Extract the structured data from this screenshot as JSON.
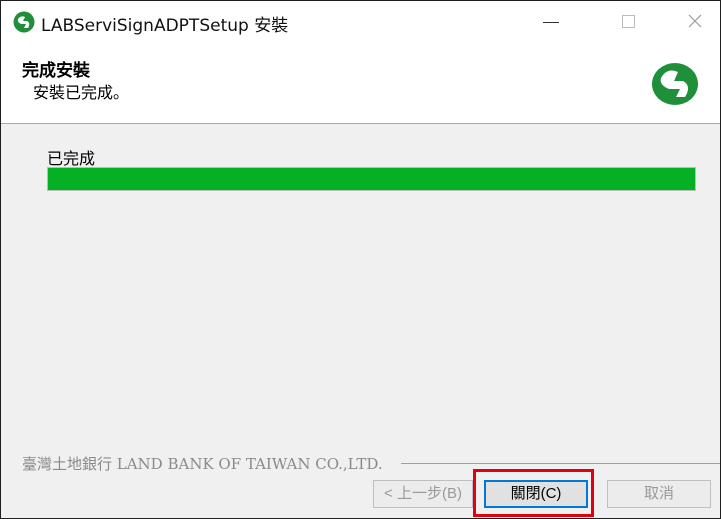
{
  "window": {
    "title": "LABServiSignADPTSetup 安裝",
    "controls": {
      "minimize": "—",
      "maximize": "□",
      "close": "✕"
    }
  },
  "header": {
    "title": "完成安裝",
    "subtitle": "安裝已完成。",
    "logo_icon": "land-bank-logo-icon"
  },
  "main": {
    "status_label": "已完成",
    "progress_percent": 100,
    "progress_color": "#06b025"
  },
  "branding": {
    "text": "臺灣土地銀行 LAND BANK OF TAIWAN CO.,LTD."
  },
  "buttons": {
    "back": "< 上一步(B)",
    "close": "關閉(C)",
    "cancel": "取消"
  },
  "colors": {
    "accent": "#0078d7",
    "highlight": "#e0000f",
    "brand_green": "#1f8f3a"
  }
}
